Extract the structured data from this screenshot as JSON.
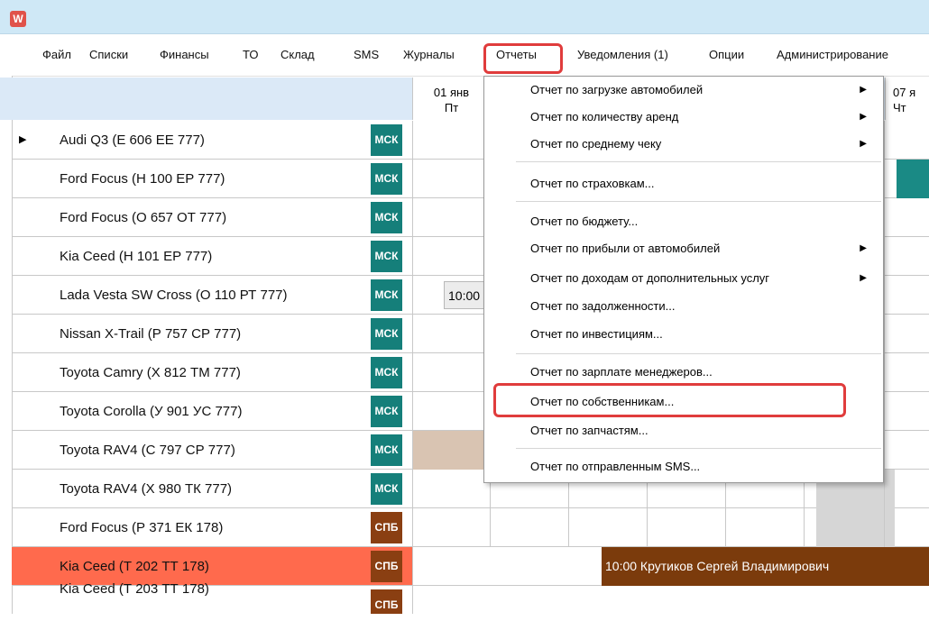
{
  "app": {
    "icon_glyph": "W"
  },
  "menubar": {
    "items": [
      "Файл",
      "Списки",
      "Финансы",
      "ТО",
      "Склад",
      "SMS",
      "Журналы",
      "Отчеты",
      "Уведомления (1)",
      "Опции",
      "Администрирование"
    ],
    "active": "Отчеты"
  },
  "grid": {
    "dates": [
      {
        "date": "01 янв",
        "day": "Пт"
      },
      {
        "date": "07 я",
        "day": "Чт"
      }
    ],
    "rows": [
      {
        "name": "Audi Q3 (Е 606 ЕЕ 777)",
        "city": "МСК",
        "current": true
      },
      {
        "name": "Ford Focus (Н 100 ЕР 777)",
        "city": "МСК"
      },
      {
        "name": "Ford Focus (О 657 ОТ 777)",
        "city": "МСК"
      },
      {
        "name": "Kia Ceed (Н 101 ЕР 777)",
        "city": "МСК"
      },
      {
        "name": "Lada Vesta SW Cross (О 110 РТ 777)",
        "city": "МСК"
      },
      {
        "name": "Nissan X-Trail (Р 757 СР 777)",
        "city": "МСК"
      },
      {
        "name": "Toyota Camry (Х 812 ТМ 777)",
        "city": "МСК"
      },
      {
        "name": "Toyota Corolla (У 901 УС 777)",
        "city": "МСК"
      },
      {
        "name": "Toyota RAV4 (С 797 СР 777)",
        "city": "МСК"
      },
      {
        "name": "Toyota RAV4 (Х 980 ТК 777)",
        "city": "МСК"
      },
      {
        "name": "Ford Focus (Р 371 ЕК 178)",
        "city": "СПБ"
      },
      {
        "name": "Kia Ceed (Т 202 ТТ 178)",
        "city": "СПБ",
        "selected": true
      },
      {
        "name": "Kia Ceed (Т 203 ТТ 178)",
        "city": "СПБ"
      }
    ],
    "bookings": {
      "lada": "10:00",
      "kia_spb": "10:00 Крутиков Сергей Владимирович"
    }
  },
  "dropdown": {
    "items": [
      {
        "label": "Отчет по загрузке автомобилей",
        "submenu": true
      },
      {
        "label": "Отчет по количеству аренд",
        "submenu": true
      },
      {
        "label": "Отчет по среднему чеку",
        "submenu": true
      },
      {
        "label": "Отчет по страховкам...",
        "submenu": false
      },
      {
        "label": "Отчет по бюджету...",
        "submenu": false
      },
      {
        "label": "Отчет по прибыли от автомобилей",
        "submenu": true
      },
      {
        "label": "Отчет по доходам от дополнительных услуг",
        "submenu": true
      },
      {
        "label": "Отчет по задолженности...",
        "submenu": false
      },
      {
        "label": "Отчет по инвестициям...",
        "submenu": false
      },
      {
        "label": "Отчет по зарплате менеджеров...",
        "submenu": false
      },
      {
        "label": "Отчет по собственникам...",
        "submenu": false,
        "highlighted": true
      },
      {
        "label": "Отчет по запчастям...",
        "submenu": false
      },
      {
        "label": "Отчет по отправленным SMS...",
        "submenu": false
      }
    ],
    "submenu_glyph": "▶"
  },
  "colors": {
    "msk": "#157f7a",
    "spb": "#8a3f12",
    "selected_row": "#ff6a4d",
    "booking_teal": "#1a8a85",
    "booking_brown": "#7b3b0c",
    "booking_tan": "#d9c4b2",
    "highlight": "#e03c3c"
  }
}
